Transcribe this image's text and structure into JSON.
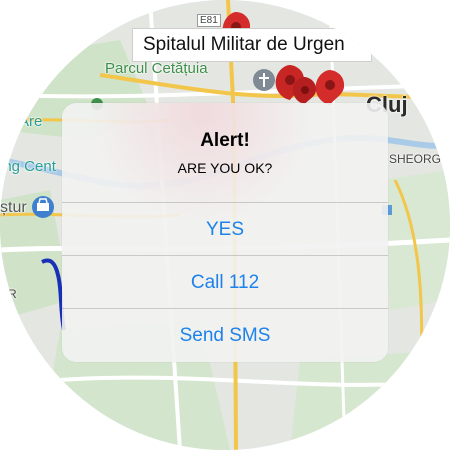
{
  "map": {
    "pin_label": "Spitalul Militar de Urgen",
    "labels": {
      "parcul": "Parcul Cetățuia",
      "cluj": "Cluj",
      "cluj_area": "uj Are",
      "center": "ing Cent",
      "eghorg": "SHEORGH",
      "stur": "ștur",
      "r_letter": "R",
      "road_e81": "E81"
    }
  },
  "alert": {
    "title": "Alert!",
    "message": "ARE YOU OK?",
    "buttons": [
      "YES",
      "Call 112",
      "Send SMS"
    ]
  },
  "colors": {
    "action_blue": "#1d82ea",
    "pin_red": "#d42b2b",
    "route_blue": "#1a2fb8",
    "road_yellow": "#f2c64a"
  },
  "icons": [
    "church-icon",
    "shopping-icon",
    "map-pin-icon",
    "park-icon"
  ]
}
